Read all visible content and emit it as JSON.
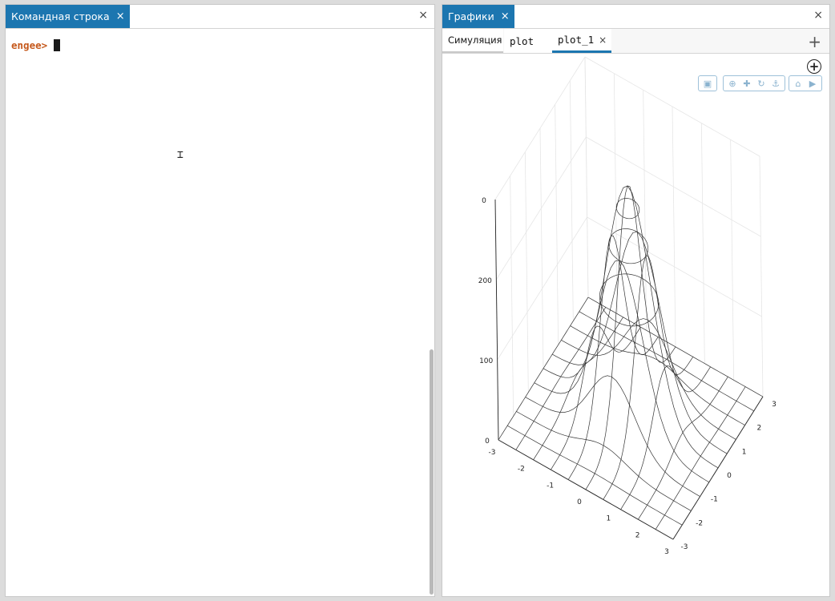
{
  "left_panel": {
    "tab_label": "Командная строка",
    "tab_close": "×",
    "close": "×",
    "prompt": "engee>"
  },
  "right_panel": {
    "tab_label": "Графики",
    "tab_close": "×",
    "close": "×",
    "tabs": [
      {
        "label": "Симуляция"
      },
      {
        "label": "plot"
      },
      {
        "label": "plot_1",
        "close": "×",
        "active": true
      }
    ],
    "add_tab": "+",
    "toolbar": {
      "icons": [
        "camera-icon",
        "zoom-icon",
        "pan-icon",
        "orbit-icon",
        "turntable-icon",
        "reset-home-icon",
        "reset-camera-icon"
      ]
    },
    "zoom_plus": "+"
  },
  "chart_data": {
    "type": "surface",
    "title": "",
    "x_ticks": [
      "-3",
      "-2",
      "-1",
      "0",
      "1",
      "2",
      "3"
    ],
    "y_ticks": [
      "-3",
      "-2",
      "-1",
      "0",
      "1",
      "2",
      "3"
    ],
    "z_ticks": [
      "0",
      "100",
      "200",
      "0"
    ],
    "xlim": [
      -3,
      3
    ],
    "ylim": [
      -3,
      3
    ],
    "zlim": [
      0,
      300
    ],
    "surface_peak": {
      "x": 0,
      "y": 0,
      "z": 290
    },
    "grid": true
  }
}
